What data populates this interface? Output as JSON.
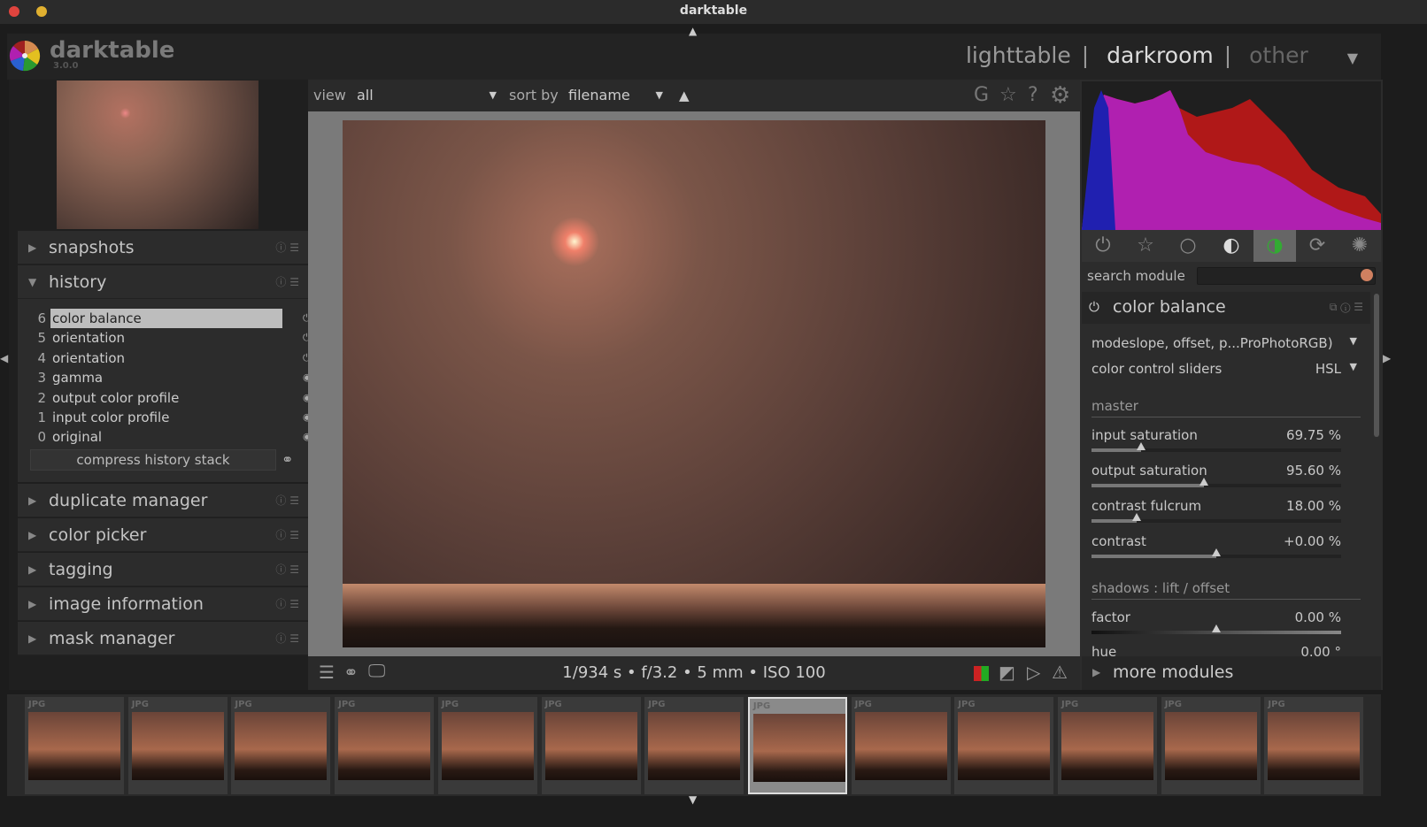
{
  "window": {
    "title": "darktable"
  },
  "app": {
    "name": "darktable",
    "version": "3.0.0"
  },
  "views": {
    "items": [
      "lighttable",
      "darkroom",
      "other"
    ],
    "active": "darkroom",
    "separator": "|"
  },
  "left_panel": {
    "modules_top": [
      {
        "label": "snapshots"
      },
      {
        "label": "history"
      }
    ],
    "history": [
      {
        "n": "6",
        "label": "color balance",
        "selected": true,
        "icon": "power-icon"
      },
      {
        "n": "5",
        "label": "orientation",
        "icon": "power-icon"
      },
      {
        "n": "4",
        "label": "orientation",
        "icon": "power-icon"
      },
      {
        "n": "3",
        "label": "gamma",
        "icon": "always-on-icon"
      },
      {
        "n": "2",
        "label": "output color profile",
        "icon": "always-on-icon"
      },
      {
        "n": "1",
        "label": "input color profile",
        "icon": "always-on-icon"
      },
      {
        "n": "0",
        "label": "original",
        "icon": "always-on-icon"
      }
    ],
    "compress_label": "compress history stack",
    "modules_bottom": [
      {
        "label": "duplicate manager"
      },
      {
        "label": "color picker"
      },
      {
        "label": "tagging"
      },
      {
        "label": "image information"
      },
      {
        "label": "mask manager"
      }
    ]
  },
  "topbar": {
    "view_label": "view",
    "view_value": "all",
    "sort_label": "sort by",
    "sort_value": "filename",
    "icons": [
      "G",
      "☆",
      "?",
      "⚙"
    ]
  },
  "exif": "1/934 s • f/3.2 • 5 mm • ISO 100",
  "right_panel": {
    "search_label": "search module",
    "module_title": "color balance",
    "mode_label": "modeslope, offset, p...ProPhotoRGB)",
    "sliders_label": "color control sliders",
    "sliders_value": "HSL",
    "section_master": "master",
    "params": [
      {
        "label": "input saturation",
        "value": "69.75 %",
        "pos": 0.2
      },
      {
        "label": "output saturation",
        "value": "95.60 %",
        "pos": 0.45
      },
      {
        "label": "contrast fulcrum",
        "value": "18.00 %",
        "pos": 0.18
      },
      {
        "label": "contrast",
        "value": "+0.00 %",
        "pos": 0.5
      }
    ],
    "section_shadows": "shadows : lift / offset",
    "factor": {
      "label": "factor",
      "value": "0.00 %",
      "pos": 0.5
    },
    "hue": {
      "label": "hue",
      "value": "0.00 °"
    },
    "more_modules": "more modules"
  },
  "filmstrip": {
    "label": "JPG",
    "count": 13,
    "selected_index": 7
  },
  "colors": {
    "accent_bg": "#2c2c2c",
    "histogram_red": "#b01818",
    "histogram_magenta": "#b020b0",
    "histogram_blue": "#2020b0"
  }
}
